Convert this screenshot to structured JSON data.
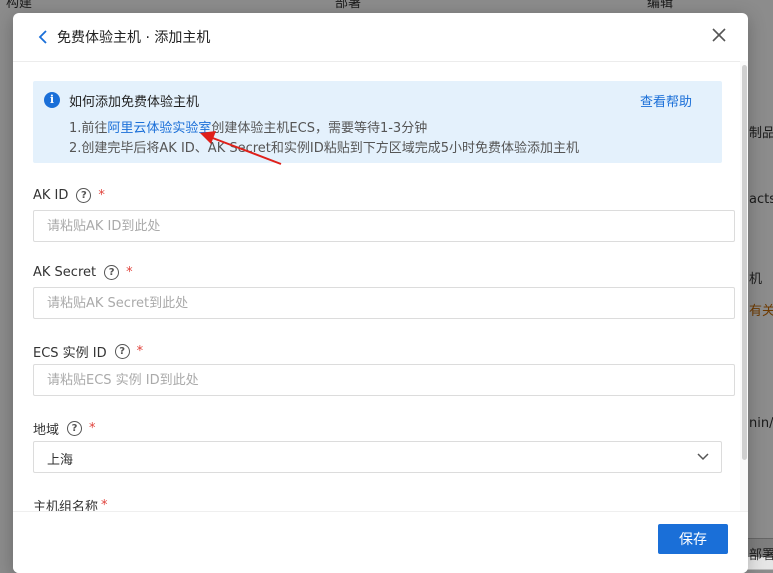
{
  "background": {
    "header_left": "构建",
    "header_mid": "部署",
    "header_right": "编辑",
    "side_texts": [
      "制品",
      "acts",
      "机",
      "有关",
      "nin/a",
      "部署"
    ]
  },
  "dialog": {
    "title": "免费体验主机 · 添加主机",
    "info": {
      "title": "如何添加免费体验主机",
      "help_link": "查看帮助",
      "step1_prefix": "1.前往",
      "step1_link": "阿里云体验实验室",
      "step1_suffix": "创建体验主机ECS，需要等待1-3分钟",
      "step2": "2.创建完毕后将AK ID、AK Secret和实例ID粘贴到下方区域完成5小时免费体验添加主机"
    },
    "fields": {
      "ak_id": {
        "label": "AK ID",
        "required": "*",
        "placeholder": "请粘贴AK ID到此处"
      },
      "ak_secret": {
        "label": "AK Secret",
        "required": "*",
        "placeholder": "请粘贴AK Secret到此处"
      },
      "ecs_id": {
        "label": "ECS 实例 ID",
        "required": "*",
        "placeholder": "请粘贴ECS 实例 ID到此处"
      },
      "region": {
        "label": "地域",
        "required": "*",
        "value": "上海"
      },
      "host_group": {
        "label": "主机组名称",
        "required": "*"
      }
    },
    "help_glyph": "?",
    "save_label": "保存"
  },
  "colors": {
    "primary": "#1a6fd8",
    "info_bg": "#e4f1fc",
    "required": "#e0413a",
    "arrow": "#e0201a"
  }
}
